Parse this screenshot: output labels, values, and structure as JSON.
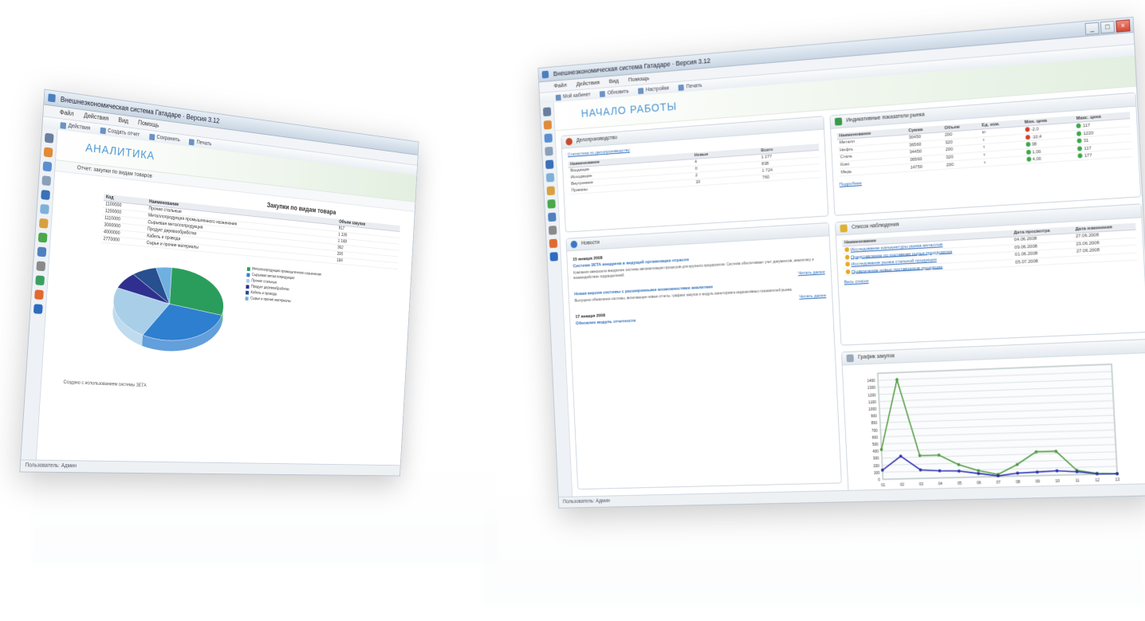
{
  "left_window": {
    "title": "Внешнеэкономическая система Гатадаре · Версия 3.12",
    "menu": [
      "Файл",
      "Действия",
      "Вид",
      "Помощь"
    ],
    "toolbar": [
      "Действия",
      "Создать отчет",
      "Сохранить",
      "Печать"
    ],
    "section_title": "АНАЛИТИКА",
    "subtoolbar": "Отчет: закупки по видам товаров",
    "report_title": "Закупки по видам товара",
    "table": {
      "headers": [
        "Код",
        "Наименование",
        "Объем закупки"
      ],
      "rows": [
        [
          "1100000",
          "Прочие стальные",
          "917"
        ],
        [
          "1200000",
          "Металлопродукция промышленного назначения",
          "1 130"
        ],
        [
          "1110000",
          "Сырьевая металлопродукция",
          "1 148"
        ],
        [
          "3000000",
          "Продукт деревообработки",
          "302"
        ],
        [
          "4000000",
          "Кабель и провода",
          "290"
        ],
        [
          "2770000",
          "Сырье и прочие материалы",
          "184"
        ]
      ]
    },
    "legend": [
      "Металлопродукция промышленного назначения",
      "Сырьевая металлопродукция",
      "Прочие стальные",
      "Продукт деревообработки",
      "Кабель и провода",
      "Сырье и прочие материалы"
    ],
    "footer_note": "Создано с использованием системы ЗЕТА",
    "status": "Пользователь: Админ"
  },
  "right_window": {
    "title": "Внешнеэкономическая система Гатадаре · Версия 3.12",
    "menu": [
      "Файл",
      "Действия",
      "Вид",
      "Помощь"
    ],
    "toolbar": [
      "Мой кабинет",
      "Обновить",
      "Настройки",
      "Печать"
    ],
    "section_title": "НАЧАЛО РАБОТЫ",
    "status": "Пользователь: Админ",
    "panel_docs": {
      "title": "Делопроизводство",
      "link": "Статистика по делопроизводству",
      "headers": [
        "Наименование",
        "Новые",
        "Всего"
      ],
      "rows": [
        [
          "Входящие",
          "4",
          "1 277"
        ],
        [
          "Исходящие",
          "0",
          "838"
        ],
        [
          "Внутренние",
          "2",
          "1 724"
        ],
        [
          "Приказы",
          "10",
          "760"
        ]
      ]
    },
    "panel_indicators": {
      "title": "Индикативные показатели рынка",
      "headers": [
        "Наименование",
        "Сумма",
        "Объем",
        "Ед. изм.",
        "Мин. цена",
        "Макс. цена"
      ],
      "rows": [
        [
          "Металл",
          "30450",
          "200",
          "кг",
          "-2,0",
          "117"
        ],
        [
          "Нефть",
          "36560",
          "320",
          "т",
          "-10,4",
          "1220"
        ],
        [
          "Сталь",
          "34450",
          "200",
          "т",
          "38",
          "31"
        ],
        [
          "Кокс",
          "36560",
          "320",
          "т",
          "1,00",
          "117"
        ],
        [
          "Медь",
          "14750",
          "200",
          "т",
          "4,00",
          "177"
        ]
      ],
      "link": "Подробнее"
    },
    "panel_news": {
      "title": "Новости",
      "items": [
        {
          "date": "15 января 2008",
          "headline": "Система ЗЕТА внедрена в ведущей организации отрасли",
          "text": "Компания завершила внедрение системы автоматизации процессов для крупного предприятия. Система обеспечивает учет документов, аналитику и взаимодействие подразделений.",
          "more": "Читать далее"
        },
        {
          "date": "",
          "headline": "Новая версия системы с расширенными возможностями аналитики",
          "text": "Выпущено обновление системы, включающее новые отчеты, графики закупок и модуль мониторинга индикативных показателей рынка.",
          "more": "Читать далее"
        },
        {
          "date": "17 января 2008",
          "headline": "Обновлен модуль отчетности",
          "text": "",
          "more": ""
        }
      ]
    },
    "panel_watch": {
      "title": "Список наблюдения",
      "headers": [
        "Наименование",
        "Дата просмотра",
        "Дата изменения"
      ],
      "rows": [
        [
          "Исследование конъюнктуры рынка металлов",
          "04.06.2008",
          "27.06.2008"
        ],
        [
          "Представление по поставкам сырья предприятия",
          "09.06.2008",
          "23.06.2008"
        ],
        [
          "Исследование рынка стальной продукции",
          "01.06.2008",
          "27.06.2008"
        ],
        [
          "Привлечение новых поставщиков продукции",
          "05.07.2008",
          ""
        ]
      ],
      "link": "Весь список"
    },
    "panel_chart": {
      "title": "График закупок"
    }
  },
  "chart_data": [
    {
      "type": "pie",
      "title": "Закупки по видам товара",
      "categories": [
        "Металлопродукция промышленного назначения",
        "Сырьевая металлопродукция",
        "Прочие стальные",
        "Продукт деревообработки",
        "Кабель и провода",
        "Сырье и прочие материалы"
      ],
      "values": [
        1130,
        1148,
        917,
        302,
        290,
        184
      ],
      "colors": [
        "#2a9d5c",
        "#2e7fcf",
        "#a9cfe8",
        "#2f2f8f",
        "#284f8f",
        "#6fb0e0"
      ]
    },
    {
      "type": "line",
      "title": "График закупок",
      "x": [
        "01",
        "02",
        "03",
        "04",
        "05",
        "06",
        "07",
        "08",
        "09",
        "10",
        "11",
        "12",
        "13"
      ],
      "ylim": [
        0,
        1500
      ],
      "yticks": [
        0,
        100,
        200,
        300,
        400,
        500,
        600,
        700,
        800,
        900,
        1000,
        1100,
        1200,
        1300,
        1400
      ],
      "series": [
        {
          "values": [
            420,
            1400,
            320,
            320,
            180,
            90,
            30,
            160,
            330,
            330,
            60,
            10,
            0
          ],
          "color": "#4e9a3e"
        },
        {
          "values": [
            130,
            320,
            120,
            100,
            90,
            50,
            10,
            40,
            50,
            60,
            40,
            5,
            0
          ],
          "color": "#2b2fb0"
        }
      ]
    }
  ]
}
